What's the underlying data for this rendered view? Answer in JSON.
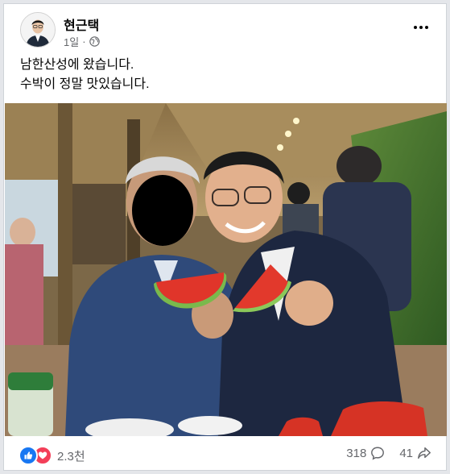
{
  "post": {
    "author": "현근택",
    "timestamp": "1일",
    "privacy_icon": "globe-icon",
    "more_icon": "more-options-icon",
    "text_lines": [
      "남한산성에 왔습니다.",
      "수박이 정말 맛있습니다."
    ]
  },
  "photo": {
    "description_icon": "photo"
  },
  "footer": {
    "reaction_icons": [
      "like-icon",
      "love-icon"
    ],
    "reaction_count": "2.3천",
    "comment_count": "318",
    "comment_icon": "comment-icon",
    "share_count": "41",
    "share_icon": "share-icon"
  },
  "colors": {
    "like_blue": "#1877f2",
    "love_red": "#f33e58",
    "secondary_text": "#65676b"
  }
}
